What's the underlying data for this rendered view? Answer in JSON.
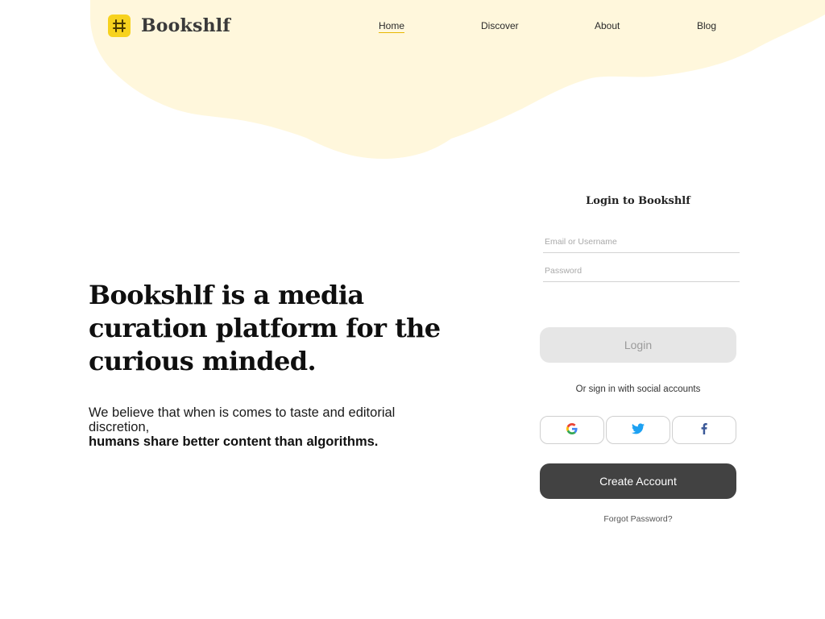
{
  "brand": {
    "name": "Bookshlf",
    "accent": "#f7d21e",
    "blob_color": "#fff7dc",
    "icon": "bookshelf-icon"
  },
  "nav": {
    "items": [
      {
        "label": "Home",
        "active": true
      },
      {
        "label": "Discover",
        "active": false
      },
      {
        "label": "About",
        "active": false
      },
      {
        "label": "Blog",
        "active": false
      }
    ]
  },
  "hero": {
    "title_line1": "Bookshlf is a media",
    "title_line2": "curation platform for the",
    "title_line3": "curious minded.",
    "subtitle": "We believe that when is comes to taste and editorial discretion,",
    "subtitle_strong": "humans share better content than algorithms."
  },
  "login": {
    "title": "Login to Bookshlf",
    "email_placeholder": "Email or Username",
    "password_placeholder": "Password",
    "login_label": "Login",
    "or_text": "Or sign in with social accounts",
    "social": [
      {
        "name": "Google",
        "icon": "google-icon"
      },
      {
        "name": "Twitter",
        "icon": "twitter-icon"
      },
      {
        "name": "Facebook",
        "icon": "facebook-icon"
      }
    ],
    "create_label": "Create Account",
    "forgot_label": "Forgot Password?"
  },
  "colors": {
    "login_disabled_bg": "#e6e6e6",
    "create_bg": "#424242",
    "twitter": "#1da1f2",
    "facebook": "#3b5998"
  }
}
